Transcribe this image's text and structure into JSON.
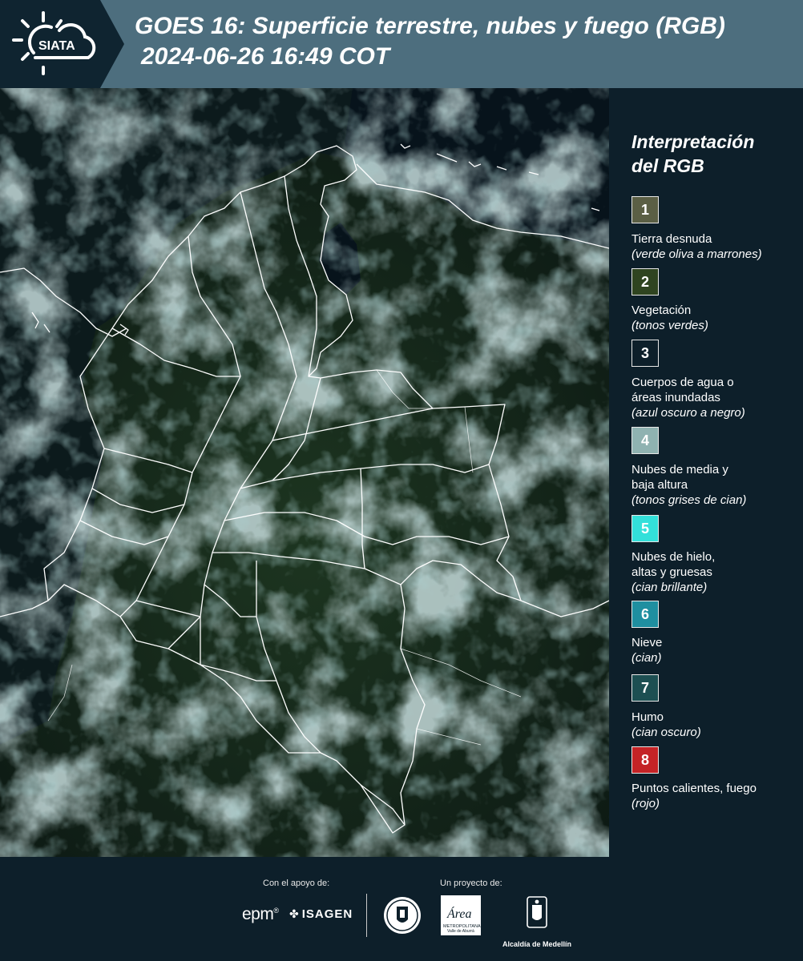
{
  "header": {
    "logo_text": "SIATA",
    "title_line1": "GOES 16: Superficie terrestre, nubes y fuego (RGB)",
    "title_line2": "2024-06-26 16:49 COT"
  },
  "legend": {
    "title_line1": "Interpretación",
    "title_line2": "del RGB",
    "items": [
      {
        "num": "1",
        "color": "#5b5f45",
        "line1": "Tierra desnuda",
        "line2": "",
        "hint": "(verde oliva a marrones)"
      },
      {
        "num": "2",
        "color": "#2f4420",
        "line1": "Vegetación",
        "line2": "",
        "hint": "(tonos verdes)"
      },
      {
        "num": "3",
        "color": "#0d1f2a",
        "line1": "Cuerpos de agua o",
        "line2": "áreas inundadas",
        "hint": "(azul oscuro a negro)"
      },
      {
        "num": "4",
        "color": "#8fb2b1",
        "line1": "Nubes de media y",
        "line2": "baja altura",
        "hint": "(tonos grises de cian)"
      },
      {
        "num": "5",
        "color": "#33e0da",
        "line1": "Nubes de hielo,",
        "line2": "altas y gruesas",
        "hint": "(cian brillante)"
      },
      {
        "num": "6",
        "color": "#1f8fa0",
        "line1": "Nieve",
        "line2": "",
        "hint": "(cian)"
      },
      {
        "num": "7",
        "color": "#1d4f52",
        "line1": "Humo",
        "line2": "",
        "hint": "(cian oscuro)"
      },
      {
        "num": "8",
        "color": "#c42326",
        "line1": "Puntos calientes, fuego",
        "line2": "",
        "hint": "(rojo)"
      }
    ]
  },
  "footer": {
    "support_label": "Con el apoyo de:",
    "project_label": "Un proyecto de:",
    "epm": "epm",
    "epm_mark": "®",
    "isagen": "ISAGEN",
    "area_logo": "Área",
    "area_sub1": "METROPOLITANA",
    "area_sub2": "Valle de Aburrá",
    "alcaldia": "Alcaldía de Medellín"
  },
  "colors": {
    "header_bg": "#4d6e7e",
    "logo_bg": "#0f2430",
    "page_bg": "#0d1f2a"
  }
}
